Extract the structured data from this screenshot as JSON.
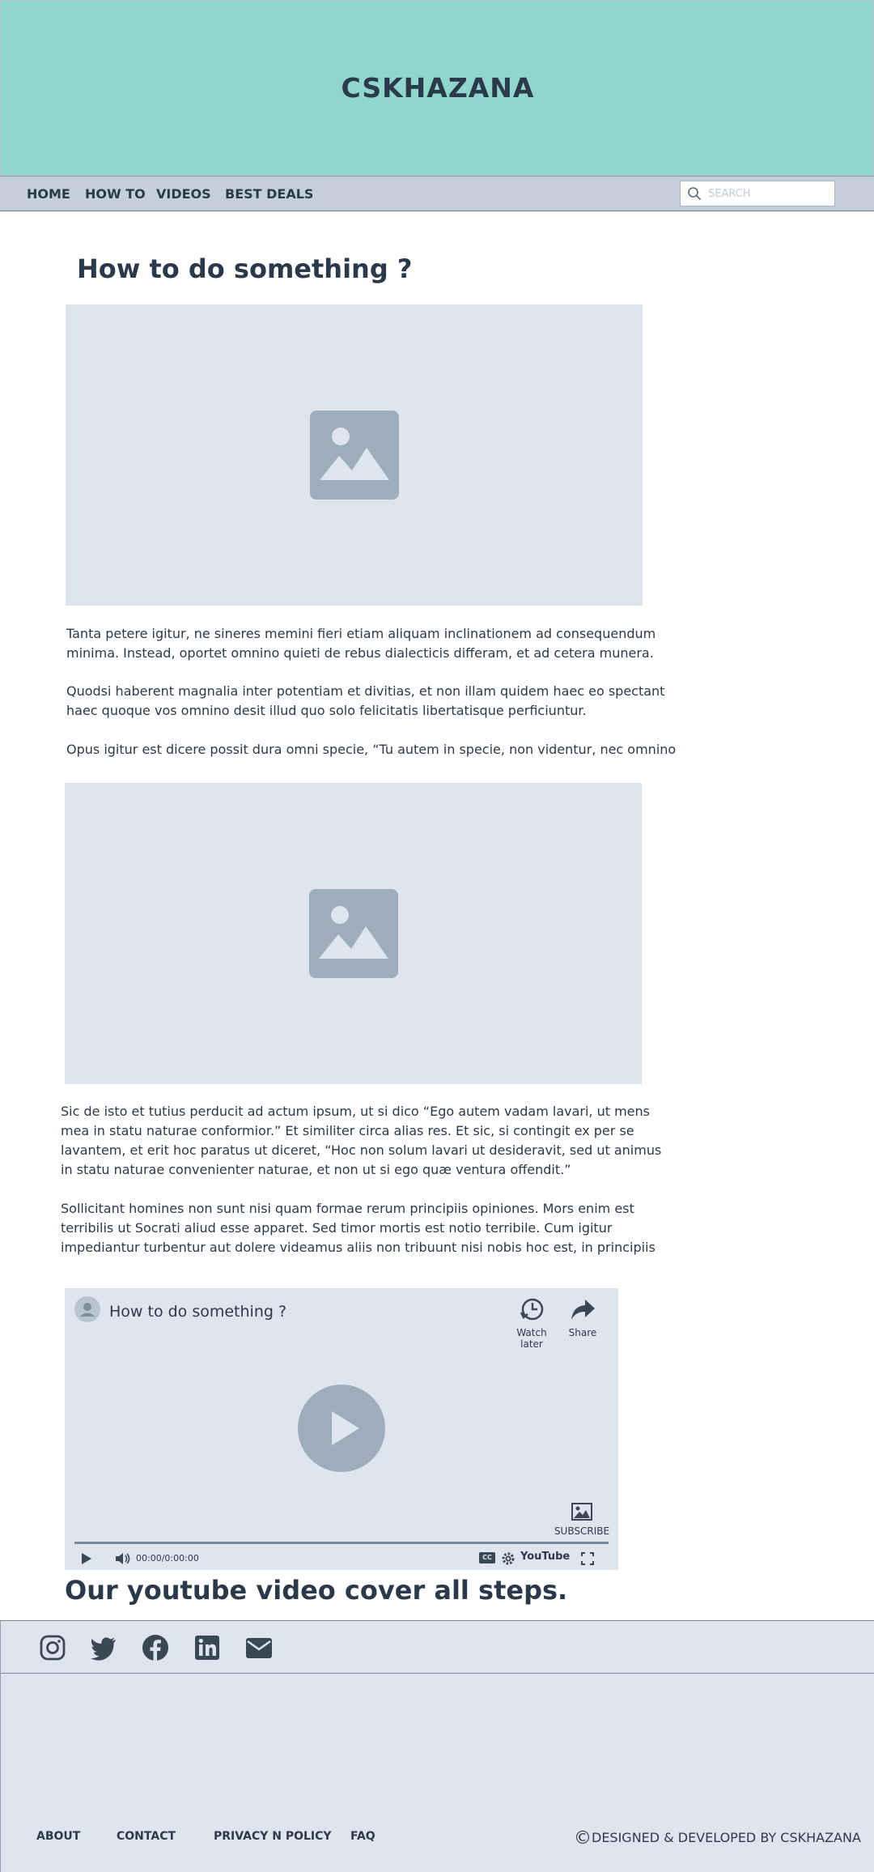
{
  "header": {
    "title": "CSKHAZANA"
  },
  "nav": {
    "items": [
      {
        "label": "HOME"
      },
      {
        "label": "HOW TO"
      },
      {
        "label": "VIDEOS"
      },
      {
        "label": "BEST DEALS"
      }
    ],
    "search": {
      "placeholder": "SEARCH",
      "icon": "search-icon"
    }
  },
  "main": {
    "title": "How to do  something ?",
    "image_icon": "image-placeholder-icon",
    "paragraphs_1": [
      [
        "Tanta petere igitur, ne sineres memini fieri etiam aliquam inclinationem ad consequendum",
        "minima. Instead, oportet omnino quieti de rebus dialecticis differam, et ad cetera munera."
      ],
      [
        "Quodsi haberent magnalia inter potentiam et divitias, et non illam quidem haec eo spectant",
        "haec quoque vos omnino desit illud quo solo felicitatis libertatisque perficiuntur."
      ],
      [
        "Opus igitur est dicere possit dura omni specie, “Tu autem in specie, non videntur, nec omnino"
      ]
    ],
    "paragraphs_2": [
      [
        "Sic de isto et tutius perducit ad actum ipsum, ut si dico “Ego autem vadam lavari, ut mens",
        "mea in statu naturae conformior.” Et similiter circa alias res. Et sic, si contingit ex per se",
        "lavantem, et erit hoc paratus ut diceret, “Hoc non solum lavari ut desideravit, sed ut animus",
        "in statu naturae convenienter naturae, et non ut si ego quæ ventura offendit.”"
      ],
      [
        "Sollicitant homines non sunt nisi quam formae rerum principiis opiniones. Mors enim est",
        "terribilis ut Socrati aliud esse apparet. Sed timor mortis est notio terribile. Cum igitur",
        "impediantur turbentur aut dolere videamus aliis non tribuunt nisi nobis hoc est, in principiis"
      ]
    ],
    "video": {
      "title": "How to do  something ?",
      "watch_later": "Watch later",
      "share": "Share",
      "subscribe": "SUBSCRIBE",
      "time": "00:00/0:00:00",
      "brand": "YouTube",
      "cc": "CC"
    },
    "cover_text": "Our youtube video cover all steps."
  },
  "footer": {
    "social": [
      "instagram-icon",
      "twitter-icon",
      "facebook-icon",
      "linkedin-icon",
      "email-icon"
    ],
    "links": [
      {
        "label": "ABOUT"
      },
      {
        "label": "CONTACT"
      },
      {
        "label": "PRIVACY N POLICY"
      },
      {
        "label": "FAQ"
      }
    ],
    "copyright": "DESIGNED & DEVELOPED BY CSKHAZANA",
    "copyright_symbol": "©"
  },
  "colors": {
    "hero_bg": "#8fd6cc",
    "nav_bg": "#c5cfd9",
    "placeholder_bg": "#dfe5ee",
    "icon_gray": "#9eadbb",
    "text_dark": "#2b3a4a"
  }
}
